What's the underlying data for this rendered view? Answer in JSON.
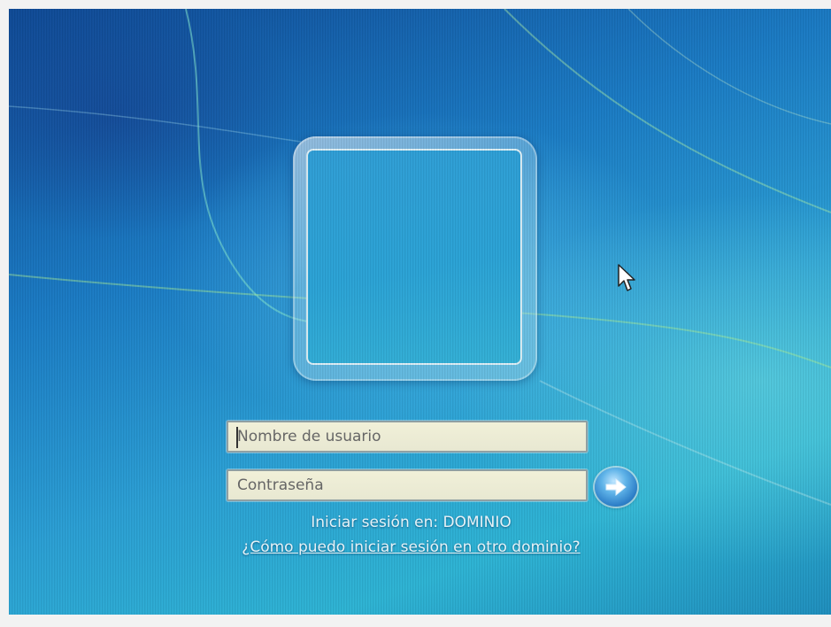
{
  "login": {
    "username_placeholder": "Nombre de usuario",
    "password_placeholder": "Contraseña",
    "domain_info": "Iniciar sesión en: DOMINIO",
    "other_domain_link": "¿Cómo puedo iniciar sesión en otro dominio?",
    "submit_icon": "arrow-right-icon"
  },
  "colors": {
    "background_top": "#0e4a97",
    "background_mid": "#2aa0d6",
    "field_background": "#f1f0d8",
    "text": "#e6f2f7"
  }
}
